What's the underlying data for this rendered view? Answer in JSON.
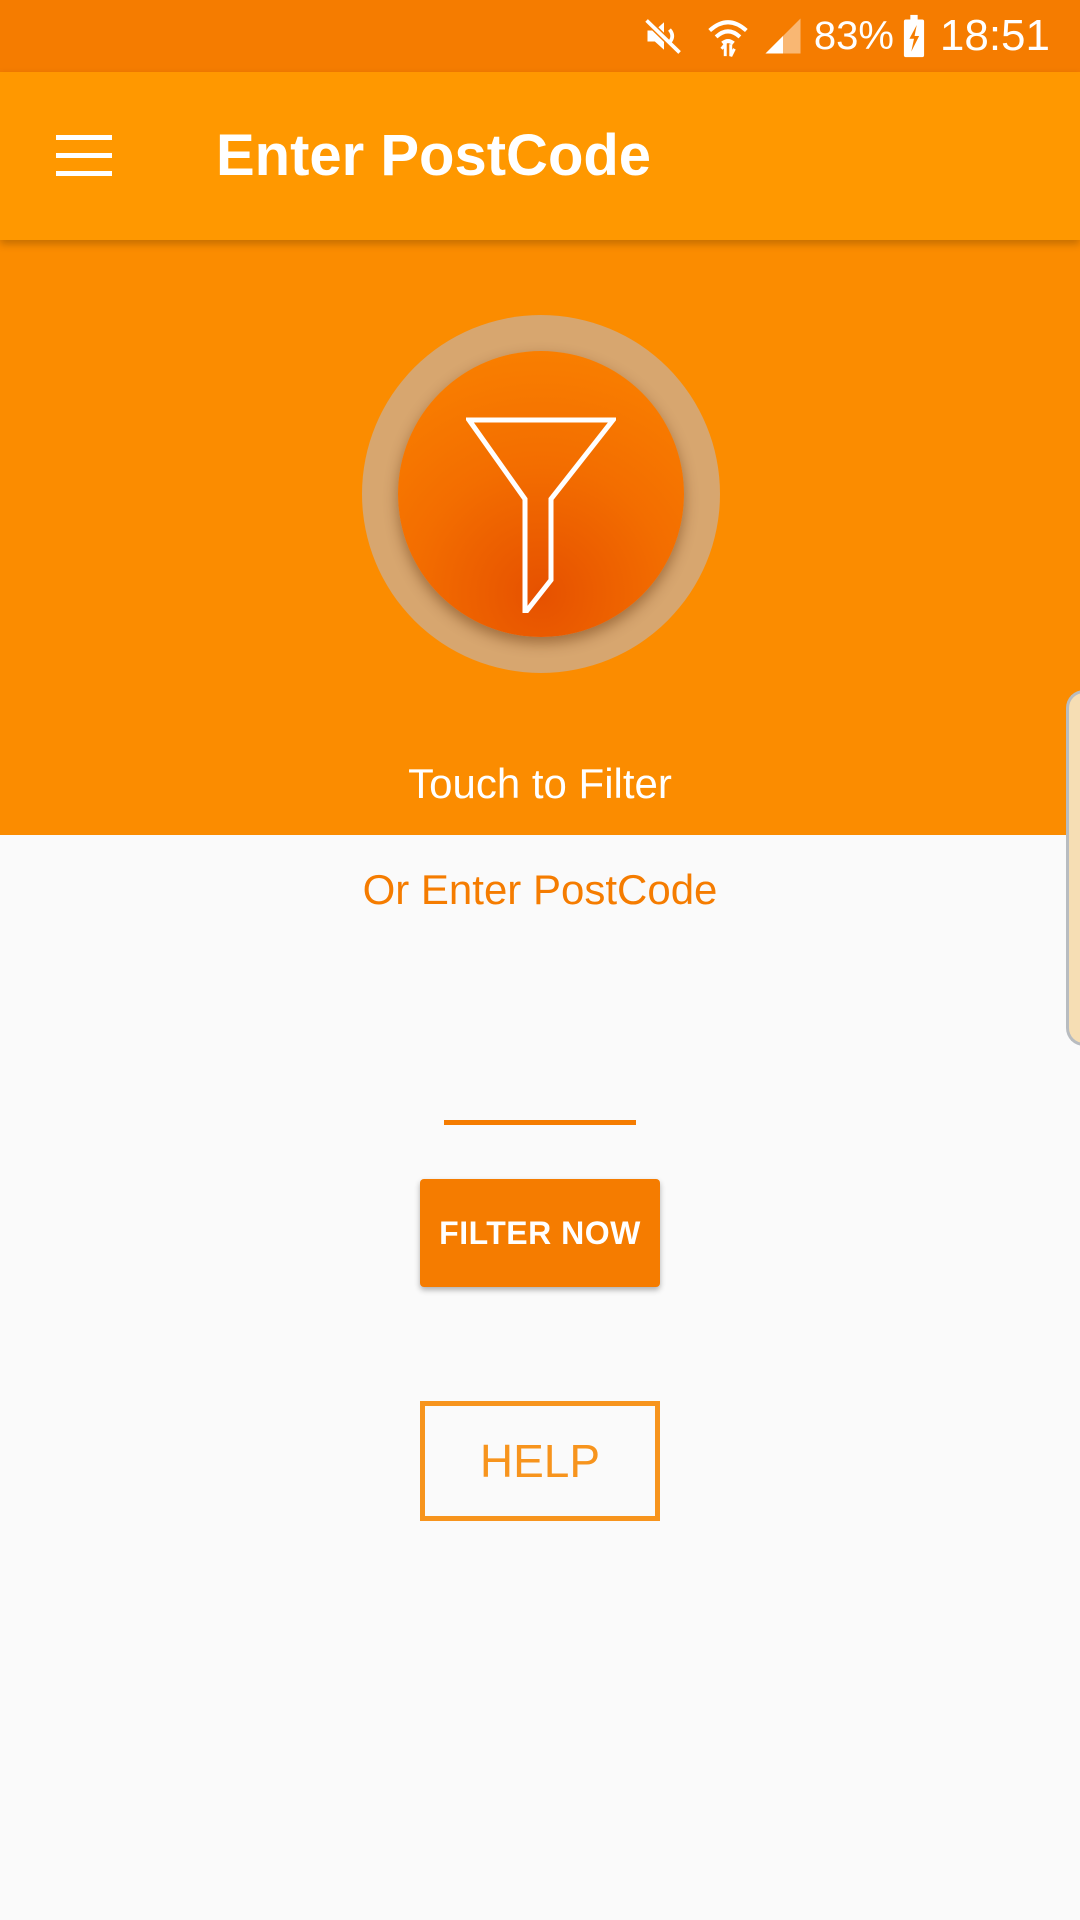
{
  "status_bar": {
    "battery": "83%",
    "time": "18:51",
    "icons": [
      "mute-icon",
      "wifi-icon",
      "signal-icon",
      "battery-charging-icon"
    ]
  },
  "app_bar": {
    "title": "Enter PostCode",
    "menu_icon": "hamburger-menu-icon"
  },
  "hero": {
    "filter_icon": "funnel-icon",
    "touch_label": "Touch to Filter"
  },
  "form": {
    "or_label": "Or Enter PostCode",
    "postcode_value": "",
    "postcode_placeholder": "",
    "filter_button_label": "FILTER NOW",
    "help_button_label": "HELP"
  },
  "colors": {
    "status_bar": "#f57c00",
    "app_bar": "#ff9800",
    "hero_background": "#fb8c00",
    "accent": "#f57c00",
    "circle_ring": "#d7a66f",
    "page_background": "#fafafa"
  }
}
